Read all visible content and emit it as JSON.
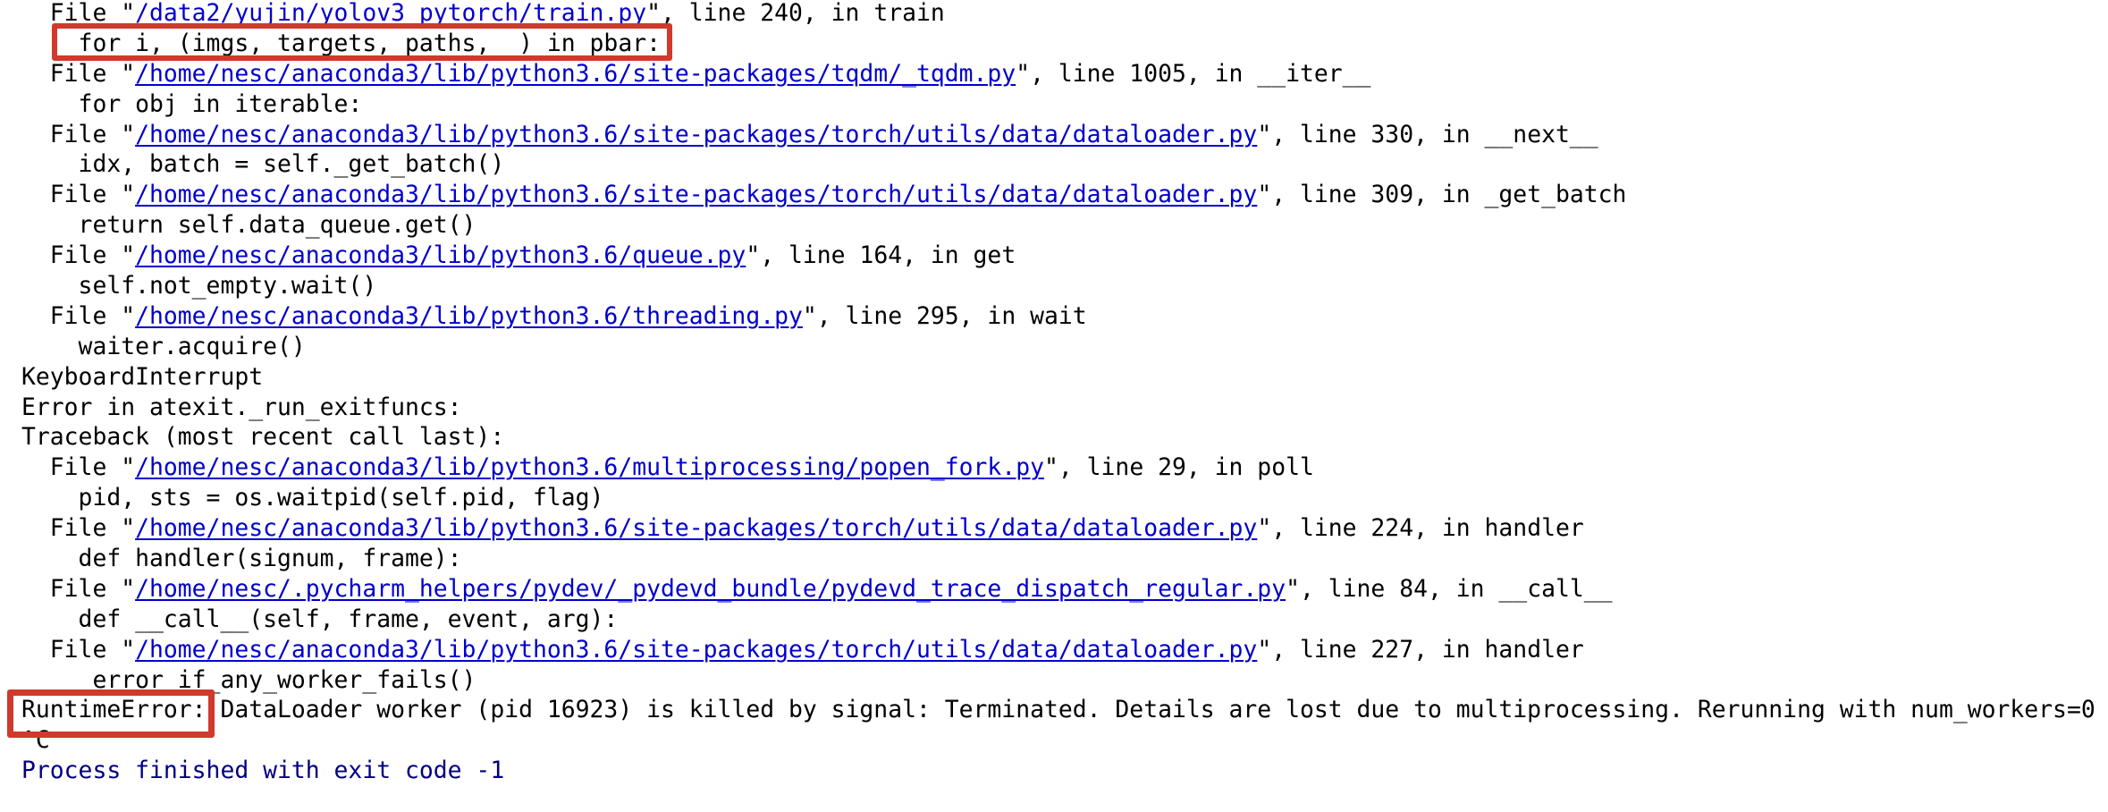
{
  "console": {
    "lines": [
      {
        "type": "file",
        "prefix": "  File \"",
        "path": "/data2/yujin/yolov3_pytorch/train.py",
        "suffix": "\", line 240, in train"
      },
      {
        "type": "code",
        "text": "    for i, (imgs, targets, paths, _) in pbar:"
      },
      {
        "type": "file",
        "prefix": "  File \"",
        "path": "/home/nesc/anaconda3/lib/python3.6/site-packages/tqdm/_tqdm.py",
        "suffix": "\", line 1005, in __iter__"
      },
      {
        "type": "code",
        "text": "    for obj in iterable:"
      },
      {
        "type": "file",
        "prefix": "  File \"",
        "path": "/home/nesc/anaconda3/lib/python3.6/site-packages/torch/utils/data/dataloader.py",
        "suffix": "\", line 330, in __next__"
      },
      {
        "type": "code",
        "text": "    idx, batch = self._get_batch()"
      },
      {
        "type": "file",
        "prefix": "  File \"",
        "path": "/home/nesc/anaconda3/lib/python3.6/site-packages/torch/utils/data/dataloader.py",
        "suffix": "\", line 309, in _get_batch"
      },
      {
        "type": "code",
        "text": "    return self.data_queue.get()"
      },
      {
        "type": "file",
        "prefix": "  File \"",
        "path": "/home/nesc/anaconda3/lib/python3.6/queue.py",
        "suffix": "\", line 164, in get"
      },
      {
        "type": "code",
        "text": "    self.not_empty.wait()"
      },
      {
        "type": "file",
        "prefix": "  File \"",
        "path": "/home/nesc/anaconda3/lib/python3.6/threading.py",
        "suffix": "\", line 295, in wait"
      },
      {
        "type": "code",
        "text": "    waiter.acquire()"
      },
      {
        "type": "code",
        "text": "KeyboardInterrupt"
      },
      {
        "type": "code",
        "text": "Error in atexit._run_exitfuncs:"
      },
      {
        "type": "code",
        "text": "Traceback (most recent call last):"
      },
      {
        "type": "file",
        "prefix": "  File \"",
        "path": "/home/nesc/anaconda3/lib/python3.6/multiprocessing/popen_fork.py",
        "suffix": "\", line 29, in poll"
      },
      {
        "type": "code",
        "text": "    pid, sts = os.waitpid(self.pid, flag)"
      },
      {
        "type": "file",
        "prefix": "  File \"",
        "path": "/home/nesc/anaconda3/lib/python3.6/site-packages/torch/utils/data/dataloader.py",
        "suffix": "\", line 224, in handler"
      },
      {
        "type": "code",
        "text": "    def handler(signum, frame):"
      },
      {
        "type": "file",
        "prefix": "  File \"",
        "path": "/home/nesc/.pycharm_helpers/pydev/_pydevd_bundle/pydevd_trace_dispatch_regular.py",
        "suffix": "\", line 84, in __call__"
      },
      {
        "type": "code",
        "text": "    def __call__(self, frame, event, arg):"
      },
      {
        "type": "file",
        "prefix": "  File \"",
        "path": "/home/nesc/anaconda3/lib/python3.6/site-packages/torch/utils/data/dataloader.py",
        "suffix": "\", line 227, in handler"
      },
      {
        "type": "code",
        "text": "    _error_if_any_worker_fails()"
      },
      {
        "type": "code",
        "text": "RuntimeError: DataLoader worker (pid 16923) is killed by signal: Terminated. Details are lost due to multiprocessing. Rerunning with num_workers=0"
      },
      {
        "type": "code",
        "text": "^C"
      },
      {
        "type": "exit",
        "text": "Process finished with exit code -1"
      }
    ]
  },
  "colors": {
    "link": "#0000cc",
    "exit_message": "#000080",
    "highlight": "#d0392b",
    "text": "#000000",
    "background": "#ffffff"
  },
  "annotations": {
    "highlighted_code_line": "for i, (imgs, targets, paths, _) in pbar:",
    "highlighted_error_label": "RuntimeError:"
  }
}
